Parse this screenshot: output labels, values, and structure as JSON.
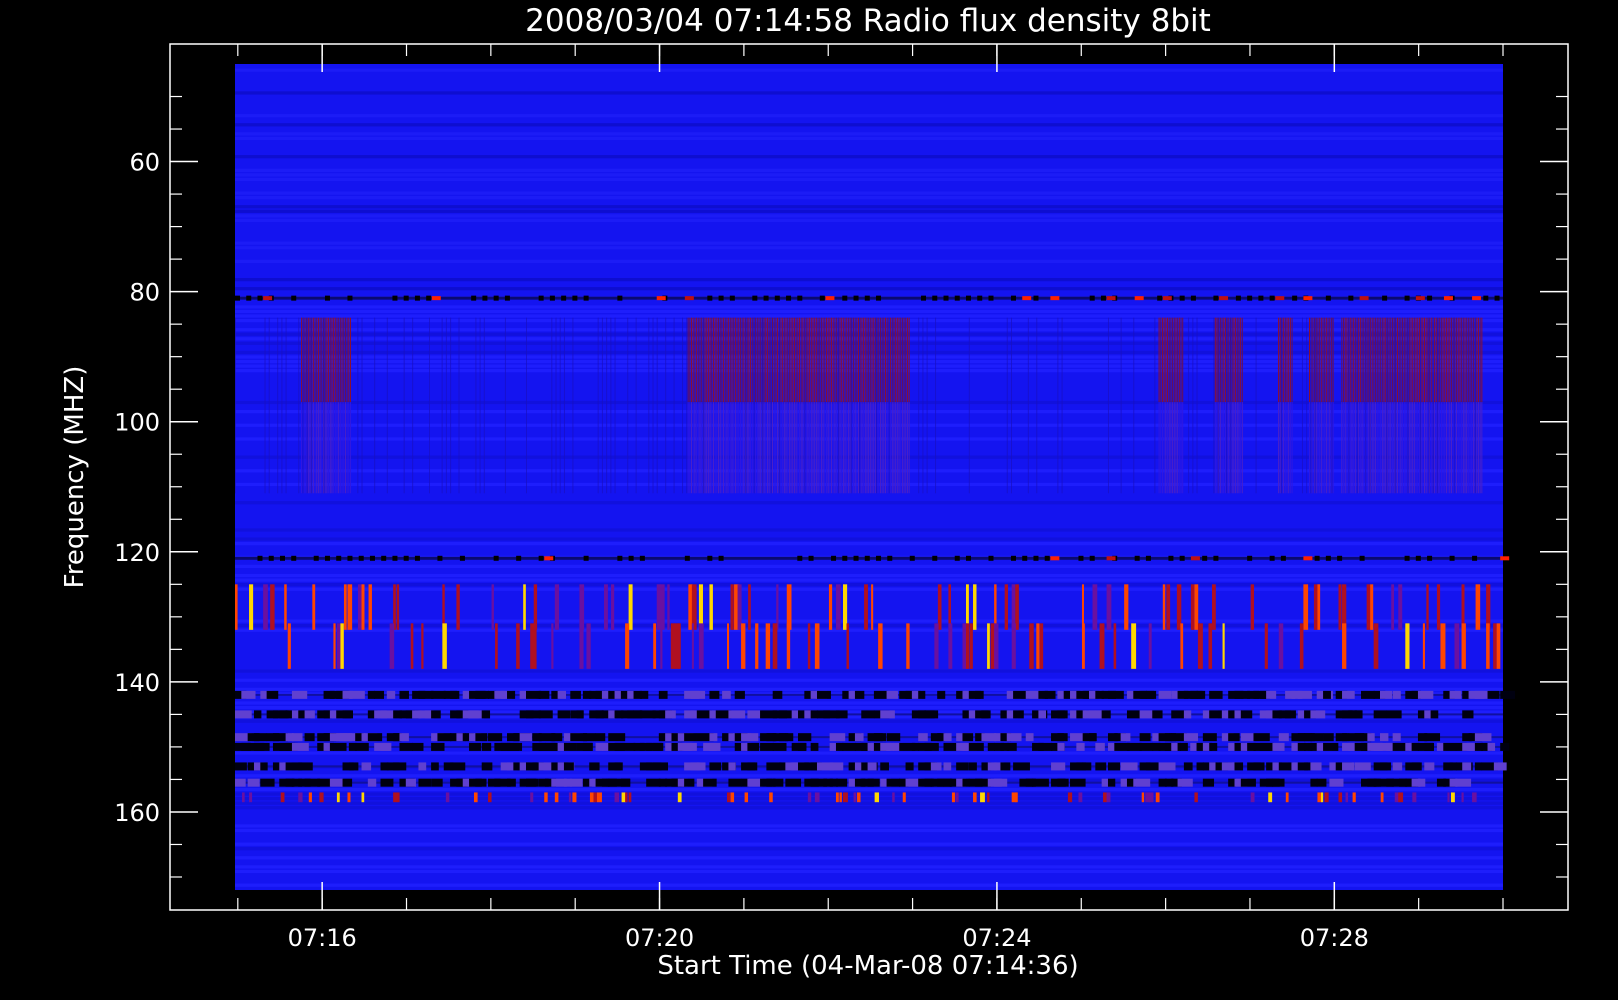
{
  "chart_data": {
    "type": "heatmap",
    "title": "2008/03/04 07:14:58 Radio flux density 8bit",
    "xlabel": "Start Time (04-Mar-08 07:14:36)",
    "ylabel": "Frequency (MHZ)",
    "x_range": [
      "07:14:58",
      "07:30:00"
    ],
    "y_range_mhz": [
      45,
      172
    ],
    "y_reversed": true,
    "x_ticks": [
      {
        "value": "07:16",
        "label": "07:16"
      },
      {
        "value": "07:20",
        "label": "07:20"
      },
      {
        "value": "07:24",
        "label": "07:24"
      },
      {
        "value": "07:28",
        "label": "07:28"
      }
    ],
    "y_ticks": [
      {
        "value": 60,
        "label": "60"
      },
      {
        "value": 80,
        "label": "80"
      },
      {
        "value": 100,
        "label": "100"
      },
      {
        "value": 120,
        "label": "120"
      },
      {
        "value": 140,
        "label": "140"
      },
      {
        "value": 160,
        "label": "160"
      }
    ],
    "colormap": [
      "#000000",
      "#0000ff",
      "#8b0000",
      "#ff4500",
      "#ffd700",
      "#ffffff"
    ],
    "background_color": "#1414f0",
    "features": [
      {
        "type": "interference-band",
        "freq_mhz": [
          84,
          111
        ],
        "intervals": [
          [
            "07:15:45",
            "07:16:20"
          ],
          [
            "07:20:20",
            "07:22:58"
          ],
          [
            "07:25:55",
            "07:26:12"
          ],
          [
            "07:26:35",
            "07:26:55"
          ],
          [
            "07:27:20",
            "07:27:30"
          ],
          [
            "07:27:42",
            "07:28:00"
          ],
          [
            "07:28:05",
            "07:29:45"
          ]
        ]
      },
      {
        "type": "dark-line",
        "freq_mhz": 81
      },
      {
        "type": "dark-line",
        "freq_mhz": 121
      },
      {
        "type": "dark-lines",
        "freq_mhz": [
          142,
          145,
          148.5,
          150,
          153,
          155.5
        ]
      },
      {
        "type": "bursts",
        "freq_mhz": [
          125,
          132
        ]
      },
      {
        "type": "bursts",
        "freq_mhz": [
          131,
          138
        ]
      },
      {
        "type": "bursts",
        "freq_mhz": [
          157,
          158.5
        ]
      }
    ]
  }
}
